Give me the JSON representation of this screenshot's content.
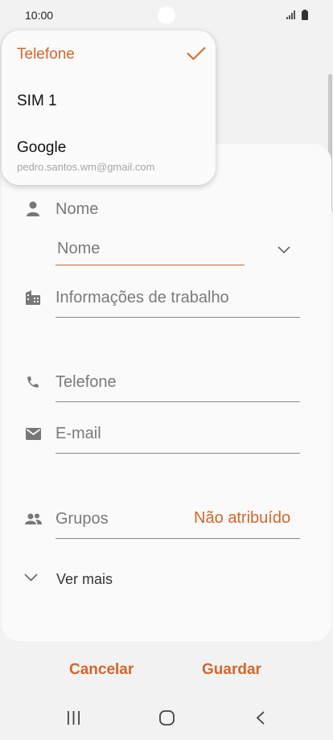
{
  "status_bar": {
    "time": "10:00",
    "signal_icon": "signal-icon",
    "battery_icon": "battery-icon"
  },
  "form": {
    "name_section_label": "Nome",
    "name_field_placeholder": "Nome",
    "work_info_placeholder": "Informações de trabalho",
    "phone_placeholder": "Telefone",
    "email_placeholder": "E-mail",
    "groups_label": "Grupos",
    "groups_value": "Não atribuído",
    "more_label": "Ver mais"
  },
  "storage_dropdown": {
    "items": [
      {
        "label": "Telefone",
        "selected": true
      },
      {
        "label": "SIM 1",
        "selected": false
      },
      {
        "label": "Google",
        "selected": false,
        "account": "pedro.santos.wm@gmail.com"
      }
    ]
  },
  "actions": {
    "cancel": "Cancelar",
    "save": "Guardar"
  },
  "colors": {
    "accent": "#d4662a",
    "background": "#f2f2f2",
    "card": "#fafafa"
  },
  "nav_bar": {
    "icons": [
      "recent-apps-icon",
      "home-icon",
      "back-icon"
    ]
  }
}
